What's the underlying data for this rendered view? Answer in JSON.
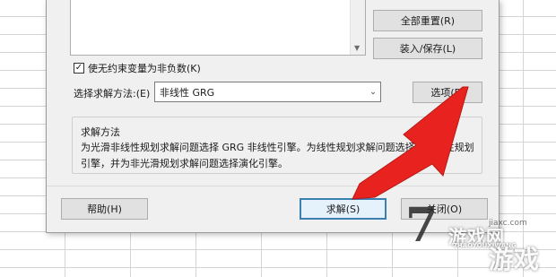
{
  "dialog": {
    "reset_all_label": "全部重置(R)",
    "load_save_label": "装入/保存(L)",
    "nonneg_checkbox_label": "使无约束变量为非负数(K)",
    "nonneg_checked": true,
    "method_label": "选择求解方法:(E)",
    "method_selected": "非线性 GRG",
    "options_label": "选项(P)",
    "group_title": "求解方法",
    "group_text": "为光滑非线性规划求解问题选择 GRG 非线性引擎。为线性规划求解问题选择单纯线性规划引擎，并为非光滑规划求解问题选择演化引擎。",
    "help_label": "帮助(H)",
    "solve_label": "求解(S)",
    "close_label": "关闭(O)"
  },
  "overlay": {
    "arrow_color": "#e8231f"
  },
  "watermark": {
    "glyph": "7",
    "site": "jiaxc.com",
    "main": "游戏网",
    "pinyin": "7HAOYOUXIWANG",
    "main2": "游戏"
  }
}
